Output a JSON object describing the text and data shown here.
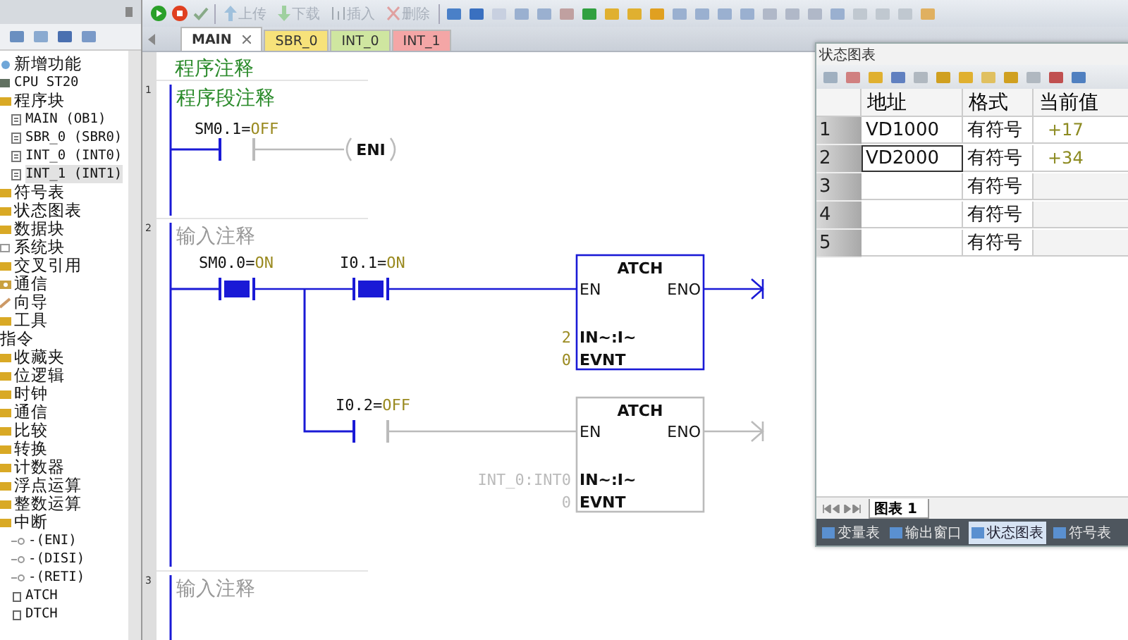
{
  "explorer": {
    "project": [
      {
        "label": "新增功能",
        "kind": "feature",
        "selected": false
      },
      {
        "label": "CPU ST20",
        "kind": "cpu",
        "selected": false
      },
      {
        "label": "程序块",
        "kind": "folder",
        "selected": false,
        "children": [
          {
            "label": "MAIN (OB1)",
            "kind": "doc",
            "selected": false
          },
          {
            "label": "SBR_0 (SBR0)",
            "kind": "doc",
            "selected": false
          },
          {
            "label": "INT_0 (INT0)",
            "kind": "doc",
            "selected": false
          },
          {
            "label": "INT_1 (INT1)",
            "kind": "doc",
            "selected": true
          }
        ]
      },
      {
        "label": "符号表",
        "kind": "folder",
        "selected": false
      },
      {
        "label": "状态图表",
        "kind": "folder",
        "selected": false
      },
      {
        "label": "数据块",
        "kind": "folder",
        "selected": false
      },
      {
        "label": "系统块",
        "kind": "blank",
        "selected": false
      },
      {
        "label": "交叉引用",
        "kind": "folder",
        "selected": false
      },
      {
        "label": "通信",
        "kind": "network",
        "selected": false
      },
      {
        "label": "向导",
        "kind": "wand",
        "selected": false
      },
      {
        "label": "工具",
        "kind": "folder",
        "selected": false
      }
    ],
    "instructions": {
      "label": "指令",
      "selected": false,
      "children": [
        {
          "label": "收藏夹",
          "kind": "folder",
          "selected": false
        },
        {
          "label": "位逻辑",
          "kind": "folder",
          "selected": false
        },
        {
          "label": "时钟",
          "kind": "folder",
          "selected": false
        },
        {
          "label": "通信",
          "kind": "folder",
          "selected": false
        },
        {
          "label": "比较",
          "kind": "folder",
          "selected": false
        },
        {
          "label": "转换",
          "kind": "folder",
          "selected": false
        },
        {
          "label": "计数器",
          "kind": "folder",
          "selected": false
        },
        {
          "label": "浮点运算",
          "kind": "folder",
          "selected": false
        },
        {
          "label": "整数运算",
          "kind": "folder",
          "selected": false
        },
        {
          "label": "中断",
          "kind": "folder",
          "selected": false,
          "children": [
            {
              "label": "-(ENI)",
              "kind": "coil",
              "selected": false
            },
            {
              "label": "-(DISI)",
              "kind": "coil",
              "selected": false
            },
            {
              "label": "-(RETI)",
              "kind": "coil",
              "selected": false
            },
            {
              "label": "ATCH",
              "kind": "box",
              "selected": false
            },
            {
              "label": "DTCH",
              "kind": "box",
              "selected": false
            }
          ]
        }
      ]
    }
  },
  "toolbar": {
    "buttons": [
      {
        "label": "上传",
        "kind": "upload",
        "disabled": true
      },
      {
        "label": "下载",
        "kind": "download",
        "disabled": true
      },
      {
        "label": "插入",
        "kind": "insert",
        "disabled": true
      },
      {
        "label": "删除",
        "kind": "delete",
        "disabled": true
      }
    ]
  },
  "tabs": [
    {
      "label": "MAIN",
      "selected": true,
      "color": "#ffffff",
      "closable": true
    },
    {
      "label": "SBR_0",
      "selected": false,
      "color": "#f7e27a",
      "closable": false
    },
    {
      "label": "INT_0",
      "selected": false,
      "color": "#cfe6a0",
      "closable": false
    },
    {
      "label": "INT_1",
      "selected": false,
      "color": "#f4a6a6",
      "closable": false
    }
  ],
  "ladder": {
    "program_comment": "程序注释",
    "networks": [
      {
        "number": "1",
        "comment": "程序段注释",
        "rungs": [
          {
            "contacts": [
              {
                "label": "SM0.1=",
                "value": "OFF",
                "closed": false
              }
            ],
            "coil": {
              "label": "ENI",
              "powered": false
            }
          }
        ]
      },
      {
        "number": "2",
        "placeholder": "输入注释",
        "rungs": [
          {
            "contacts": [
              {
                "label": "SM0.0=",
                "value": "ON",
                "closed": true
              },
              {
                "label": "I0.1=",
                "value": "ON",
                "closed": true
              }
            ],
            "box": {
              "title": "ATCH",
              "powered": true,
              "en": "EN",
              "eno": "ENO",
              "inputs": [
                {
                  "pin": "IN~:I~",
                  "value": "2"
                },
                {
                  "pin": "EVNT",
                  "value": "0"
                }
              ]
            }
          },
          {
            "contacts": [
              {
                "label": "I0.2=",
                "value": "OFF",
                "closed": false
              }
            ],
            "box": {
              "title": "ATCH",
              "powered": false,
              "en": "EN",
              "eno": "ENO",
              "inputs": [
                {
                  "pin": "IN~:I~",
                  "value": "INT_0:INT0"
                },
                {
                  "pin": "EVNT",
                  "value": "0"
                }
              ]
            }
          }
        ]
      },
      {
        "number": "3",
        "placeholder": "输入注释"
      }
    ]
  },
  "status_chart": {
    "title": "状态图表",
    "columns": [
      "地址",
      "格式",
      "当前值"
    ],
    "rows": [
      {
        "index": "1",
        "address": "VD1000",
        "format": "有符号",
        "value": "+17",
        "selected": false
      },
      {
        "index": "2",
        "address": "VD2000",
        "format": "有符号",
        "value": "+34",
        "selected": true
      },
      {
        "index": "3",
        "format": "有符号",
        "selected": false
      },
      {
        "index": "4",
        "format": "有符号",
        "selected": false
      },
      {
        "index": "5",
        "format": "有符号",
        "selected": false
      }
    ],
    "sheet_tab": "图表 1",
    "bottom_tabs": [
      {
        "label": "变量表",
        "selected": false
      },
      {
        "label": "输出窗口",
        "selected": false
      },
      {
        "label": "状态图表",
        "selected": true
      },
      {
        "label": "符号表",
        "selected": false
      }
    ]
  }
}
